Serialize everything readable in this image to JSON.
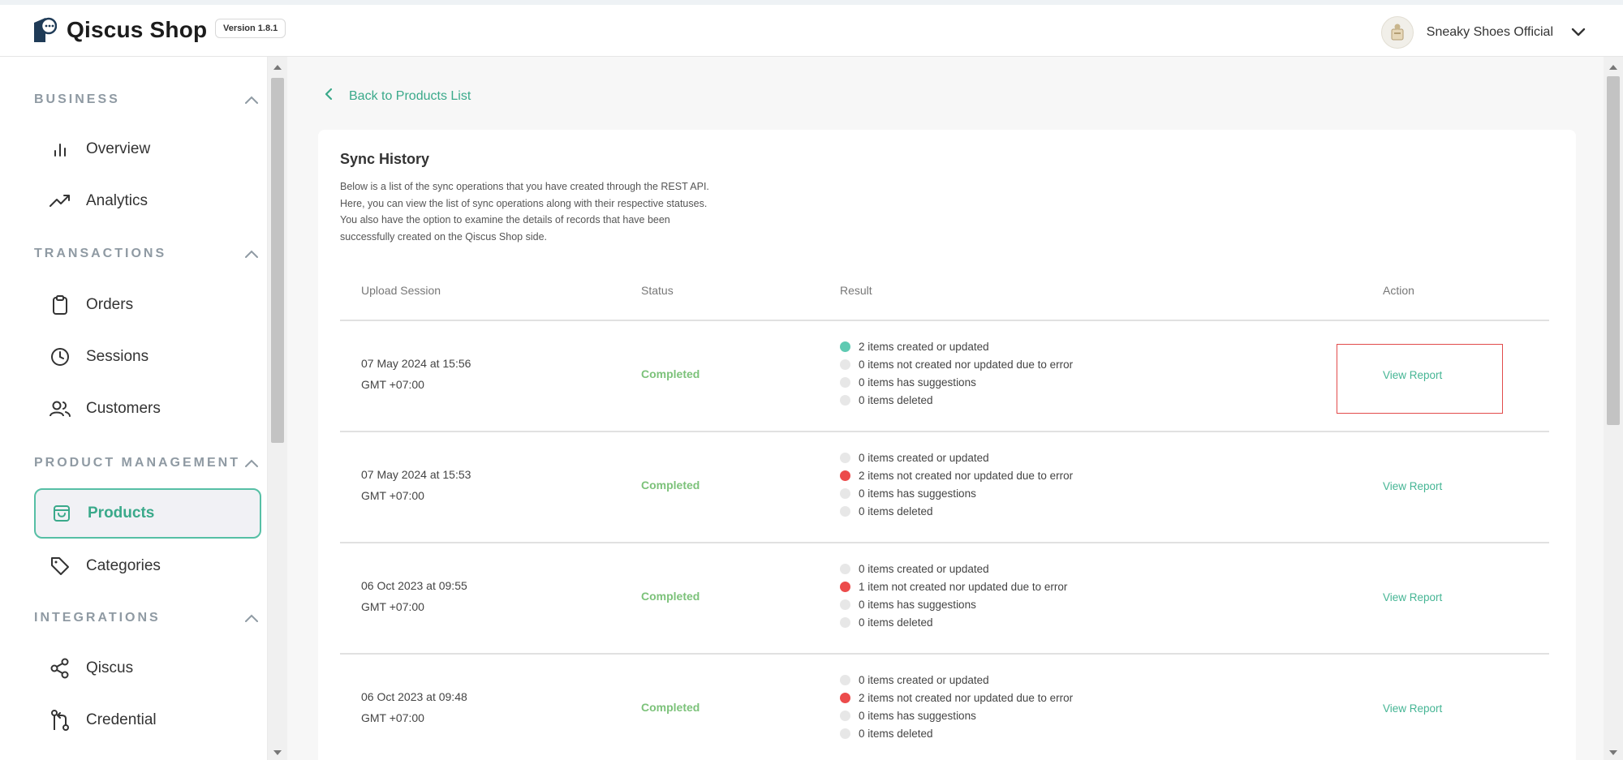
{
  "app": {
    "title": "Qiscus Shop",
    "version": "Version 1.8.1",
    "user_name": "Sneaky Shoes Official"
  },
  "colors": {
    "accent": "#3aa98a",
    "status_completed": "#7cc27a",
    "dot_green": "#5ecab2",
    "dot_red": "#ec4b4b",
    "dot_gray": "#e7e7e7",
    "highlight": "#e24b4b"
  },
  "sidebar": {
    "sections": [
      {
        "title": "BUSINESS",
        "items": [
          {
            "label": "Overview",
            "icon": "bar-chart-icon"
          },
          {
            "label": "Analytics",
            "icon": "trending-up-icon"
          }
        ]
      },
      {
        "title": "TRANSACTIONS",
        "items": [
          {
            "label": "Orders",
            "icon": "clipboard-icon"
          },
          {
            "label": "Sessions",
            "icon": "clock-icon"
          },
          {
            "label": "Customers",
            "icon": "users-icon"
          }
        ]
      },
      {
        "title": "PRODUCT MANAGEMENT",
        "items": [
          {
            "label": "Products",
            "icon": "shopping-bag-icon"
          },
          {
            "label": "Categories",
            "icon": "tag-icon"
          }
        ]
      },
      {
        "title": "INTEGRATIONS",
        "items": [
          {
            "label": "Qiscus",
            "icon": "share-icon"
          },
          {
            "label": "Credential",
            "icon": "git-pull-request-icon"
          }
        ]
      }
    ],
    "active_item": "Products"
  },
  "main": {
    "back_label": "Back to Products List",
    "card": {
      "title": "Sync History",
      "description": [
        "Below is a list of the sync operations that you have created through the REST API.",
        "Here, you can view the list of sync operations along with their respective statuses.",
        "You also have the option to examine the details of records that have been",
        "successfully created on the Qiscus Shop side."
      ],
      "columns": [
        "Upload Session",
        "Status",
        "Result",
        "Action"
      ],
      "rows": [
        {
          "date": "07 May 2024 at 15:56",
          "tz": "GMT +07:00",
          "status": "Completed",
          "results": [
            {
              "text": "2 items created or updated",
              "dot": "green"
            },
            {
              "text": "0 items not created nor updated due to error",
              "dot": "gray"
            },
            {
              "text": "0 items has suggestions",
              "dot": "gray"
            },
            {
              "text": "0 items deleted",
              "dot": "gray"
            }
          ],
          "action": "View Report"
        },
        {
          "date": "07 May 2024 at 15:53",
          "tz": "GMT +07:00",
          "status": "Completed",
          "results": [
            {
              "text": "0 items created or updated",
              "dot": "gray"
            },
            {
              "text": "2 items not created nor updated due to error",
              "dot": "red"
            },
            {
              "text": "0 items has suggestions",
              "dot": "gray"
            },
            {
              "text": "0 items deleted",
              "dot": "gray"
            }
          ],
          "action": "View Report"
        },
        {
          "date": "06 Oct 2023 at 09:55",
          "tz": "GMT +07:00",
          "status": "Completed",
          "results": [
            {
              "text": "0 items created or updated",
              "dot": "gray"
            },
            {
              "text": "1 item not created nor updated due to error",
              "dot": "red"
            },
            {
              "text": "0 items has suggestions",
              "dot": "gray"
            },
            {
              "text": "0 items deleted",
              "dot": "gray"
            }
          ],
          "action": "View Report"
        },
        {
          "date": "06 Oct 2023 at 09:48",
          "tz": "GMT +07:00",
          "status": "Completed",
          "results": [
            {
              "text": "0 items created or updated",
              "dot": "gray"
            },
            {
              "text": "2 items not created nor updated due to error",
              "dot": "red"
            },
            {
              "text": "0 items has suggestions",
              "dot": "gray"
            },
            {
              "text": "0 items deleted",
              "dot": "gray"
            }
          ],
          "action": "View Report"
        }
      ]
    }
  }
}
